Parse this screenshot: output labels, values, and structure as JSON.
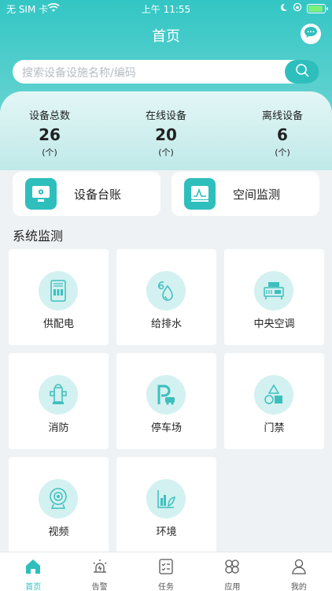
{
  "status_bar": {
    "carrier": "无 SIM 卡",
    "time": "上午 11:55"
  },
  "header": {
    "title": "首页"
  },
  "search": {
    "placeholder": "搜索设备设施名称/编码"
  },
  "stats": [
    {
      "label": "设备总数",
      "value": "26",
      "unit": "(个)"
    },
    {
      "label": "在线设备",
      "value": "20",
      "unit": "(个)"
    },
    {
      "label": "离线设备",
      "value": "6",
      "unit": "(个)"
    }
  ],
  "quick_actions": [
    {
      "label": "设备台账",
      "icon": "monitor-gear-icon"
    },
    {
      "label": "空间监测",
      "icon": "waveform-chart-icon"
    }
  ],
  "system_monitor": {
    "title": "系统监测",
    "items": [
      {
        "label": "供配电",
        "icon": "power-cabinet-icon"
      },
      {
        "label": "给排水",
        "icon": "water-drop-icon"
      },
      {
        "label": "中央空调",
        "icon": "hvac-unit-icon"
      },
      {
        "label": "消防",
        "icon": "fire-hydrant-icon"
      },
      {
        "label": "停车场",
        "icon": "parking-car-icon"
      },
      {
        "label": "门禁",
        "icon": "shapes-icon"
      },
      {
        "label": "视频",
        "icon": "camera-icon"
      },
      {
        "label": "环境",
        "icon": "plant-chart-icon"
      }
    ]
  },
  "tabbar": [
    {
      "label": "首页",
      "icon": "home-icon",
      "active": true
    },
    {
      "label": "告警",
      "icon": "alarm-light-icon",
      "active": false
    },
    {
      "label": "任务",
      "icon": "task-list-icon",
      "active": false
    },
    {
      "label": "应用",
      "icon": "apps-icon",
      "active": false
    },
    {
      "label": "我的",
      "icon": "user-icon",
      "active": false
    }
  ],
  "colors": {
    "accent": "#2ebfbd",
    "icon_bg": "#d3f1f0",
    "battery": "#7bf07b"
  }
}
